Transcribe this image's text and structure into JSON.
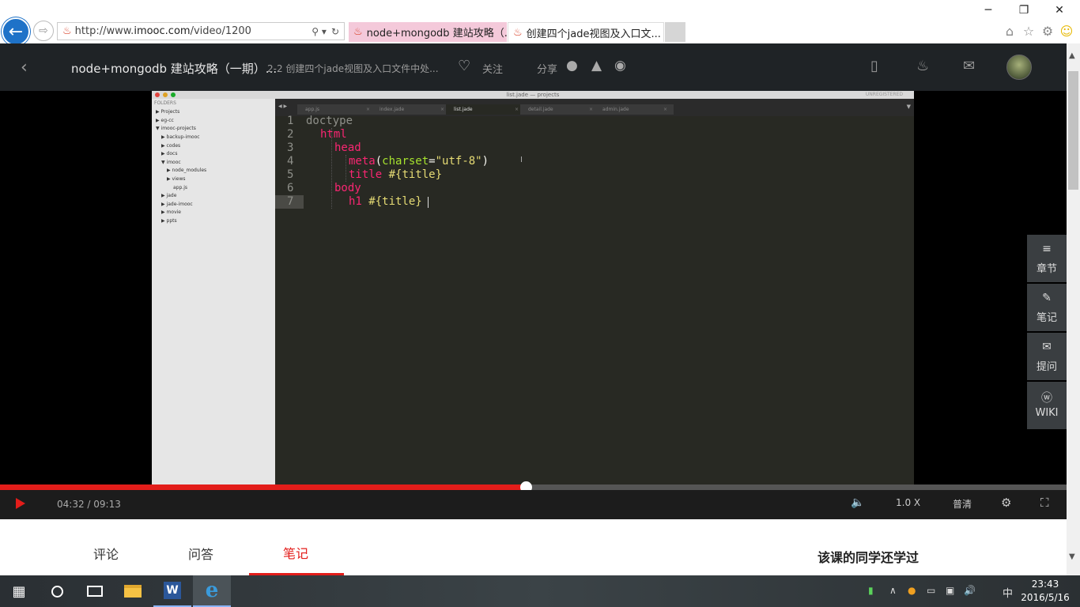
{
  "browser": {
    "address": {
      "prefix": "http://www.",
      "host": "imooc.com",
      "path": "/video/1200"
    },
    "tabs": [
      {
        "label": "node+mongodb 建站攻略（..."
      },
      {
        "label": "创建四个jade视图及入口文..."
      }
    ],
    "window_controls": {
      "minimize": "─",
      "restore": "❐",
      "close": "✕"
    },
    "toolbar_icons": [
      "home-icon",
      "favorites-star-icon",
      "settings-gear-icon",
      "smiley-feedback-icon"
    ]
  },
  "header": {
    "course_title": "node+mongodb 建站攻略（一期）...",
    "chapter_title": "2-2 创建四个jade视图及入口文件中处...",
    "follow_label": "关注",
    "share_label": "分享"
  },
  "editor": {
    "window_title": "list.jade — projects",
    "unregistered": "UNREGISTERED",
    "sidebar_header": "FOLDERS",
    "folders": [
      {
        "label": "Projects",
        "arrow": "▶"
      },
      {
        "label": "eg-cc",
        "arrow": "▶"
      },
      {
        "label": "imooc-projects",
        "arrow": "▼"
      },
      {
        "label": "backup-imooc",
        "arrow": "▶"
      },
      {
        "label": "codes",
        "arrow": "▶"
      },
      {
        "label": "docs",
        "arrow": "▶"
      },
      {
        "label": "imooc",
        "arrow": "▼"
      },
      {
        "label": "node_modules",
        "arrow": "▶"
      },
      {
        "label": "views",
        "arrow": "▶"
      },
      {
        "label": "app.js",
        "arrow": ""
      },
      {
        "label": "jade",
        "arrow": "▶"
      },
      {
        "label": "jade-imooc",
        "arrow": "▶"
      },
      {
        "label": "movie",
        "arrow": "▶"
      },
      {
        "label": "ppts",
        "arrow": "▶"
      }
    ],
    "tabs": [
      "app.js",
      "index.jade",
      "list.jade",
      "detail.jade",
      "admin.jade"
    ],
    "line_numbers": [
      "1",
      "2",
      "3",
      "4",
      "5",
      "6",
      "7"
    ],
    "code": {
      "l1": "doctype",
      "l2": "html",
      "l3": "head",
      "l4_tag": "meta",
      "l4_open": "(",
      "l4_attr": "charset",
      "l4_eq": "=",
      "l4_val": "\"utf-8\"",
      "l4_close": ")",
      "l5_tag": "title",
      "l5_expr": " #{title}",
      "l6": "body",
      "l7_tag": "h1",
      "l7_expr": " #{title}"
    }
  },
  "tools": [
    {
      "label": "章节",
      "icon": "≡"
    },
    {
      "label": "笔记",
      "icon": "✎"
    },
    {
      "label": "提问",
      "icon": "✉"
    },
    {
      "label": "WIKI",
      "icon": "ⓦ"
    }
  ],
  "player": {
    "progress": 0.4926,
    "time": "04:32 / 09:13",
    "speed": "1.0 X",
    "quality": "普清"
  },
  "page": {
    "tabs": {
      "comments": "评论",
      "qa": "问答",
      "notes": "笔记"
    },
    "also_learned": "该课的同学还学过"
  },
  "taskbar": {
    "time": "23:43",
    "date": "2016/5/16",
    "ime": "中",
    "word_letter": "W",
    "ie_letter": "e"
  }
}
